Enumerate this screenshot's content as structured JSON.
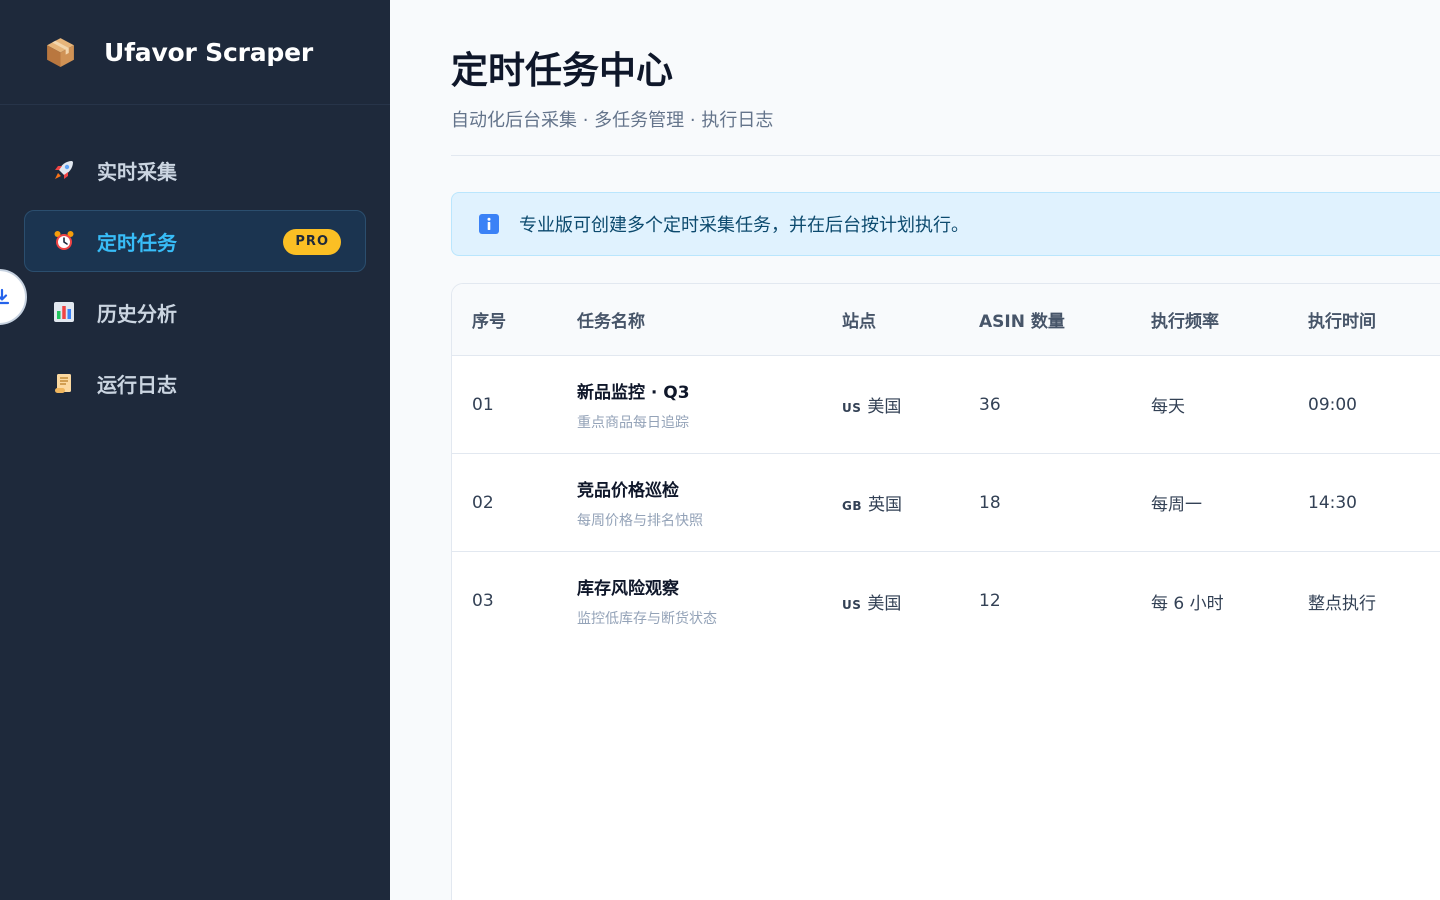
{
  "app": {
    "name": "Ufavor Scraper",
    "logo_icon": "package-box-icon"
  },
  "sidebar": {
    "items": [
      {
        "label": "实时采集",
        "icon": "rocket-icon",
        "active": false
      },
      {
        "label": "定时任务",
        "icon": "alarm-clock-icon",
        "active": true,
        "badge": "PRO"
      },
      {
        "label": "历史分析",
        "icon": "bar-chart-icon",
        "active": false
      },
      {
        "label": "运行日志",
        "icon": "scroll-icon",
        "active": false
      }
    ],
    "collapse_icon": "download-arrow-icon"
  },
  "page": {
    "title": "定时任务中心",
    "subtitle": "自动化后台采集 · 多任务管理 · 执行日志"
  },
  "info_banner": {
    "icon": "info-icon",
    "text": "专业版可创建多个定时采集任务，并在后台按计划执行。"
  },
  "table": {
    "columns": [
      "序号",
      "任务名称",
      "站点",
      "ASIN 数量",
      "执行频率",
      "执行时间"
    ],
    "rows": [
      {
        "index": "01",
        "name": "新品监控 · Q3",
        "desc": "重点商品每日追踪",
        "site_code": "US",
        "site_name": "美国",
        "asin_count": "36",
        "frequency": "每天",
        "time": "09:00"
      },
      {
        "index": "02",
        "name": "竞品价格巡检",
        "desc": "每周价格与排名快照",
        "site_code": "GB",
        "site_name": "英国",
        "asin_count": "18",
        "frequency": "每周一",
        "time": "14:30"
      },
      {
        "index": "03",
        "name": "库存风险观察",
        "desc": "监控低库存与断货状态",
        "site_code": "US",
        "site_name": "美国",
        "asin_count": "12",
        "frequency": "每 6 小时",
        "time": "整点执行"
      }
    ]
  },
  "colors": {
    "sidebar_bg": "#1e293b",
    "accent": "#38bdf8",
    "badge": "#fbbf24",
    "banner_bg": "#e0f2fe"
  }
}
